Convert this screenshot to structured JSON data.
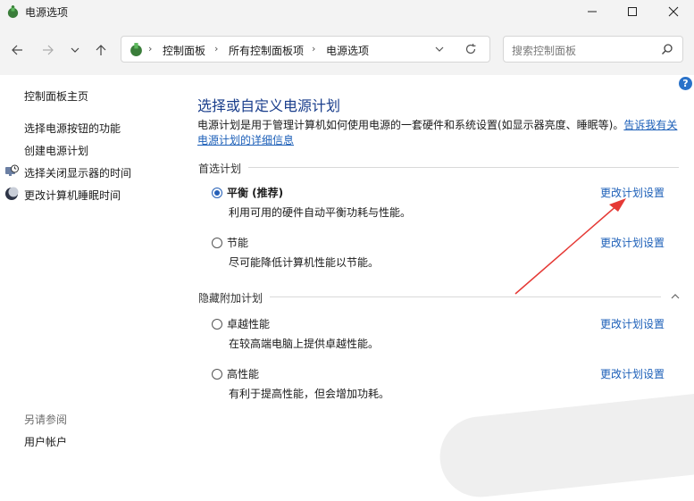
{
  "window": {
    "title": "电源选项"
  },
  "navigation": {
    "breadcrumb": [
      "控制面板",
      "所有控制面板项",
      "电源选项"
    ],
    "search_placeholder": "搜索控制面板"
  },
  "sidebar": {
    "home": "控制面板主页",
    "items": [
      {
        "label": "选择电源按钮的功能",
        "icon": ""
      },
      {
        "label": "创建电源计划",
        "icon": ""
      },
      {
        "label": "选择关闭显示器的时间",
        "icon": "monitor-clock-icon"
      },
      {
        "label": "更改计算机睡眠时间",
        "icon": "moon-icon"
      }
    ],
    "see_also_title": "另请参阅",
    "see_also_items": [
      "用户帐户"
    ]
  },
  "main": {
    "title": "选择或自定义电源计划",
    "description": "电源计划是用于管理计算机如何使用电源的一套硬件和系统设置(如显示器亮度、睡眠等)。",
    "description_link": "告诉我有关电源计划的详细信息",
    "preferred_section": "首选计划",
    "preferred_plans": [
      {
        "name": "平衡 (推荐)",
        "desc": "利用可用的硬件自动平衡功耗与性能。",
        "selected": true,
        "link": "更改计划设置"
      },
      {
        "name": "节能",
        "desc": "尽可能降低计算机性能以节能。",
        "selected": false,
        "link": "更改计划设置"
      }
    ],
    "hidden_section": "隐藏附加计划",
    "hidden_plans": [
      {
        "name": "卓越性能",
        "desc": "在较高端电脑上提供卓越性能。",
        "selected": false,
        "link": "更改计划设置"
      },
      {
        "name": "高性能",
        "desc": "有利于提高性能，但会增加功耗。",
        "selected": false,
        "link": "更改计划设置"
      }
    ]
  },
  "colors": {
    "accent_link": "#1c5fb8",
    "title_blue": "#1a3e8c",
    "annotation_arrow": "#e53935"
  }
}
